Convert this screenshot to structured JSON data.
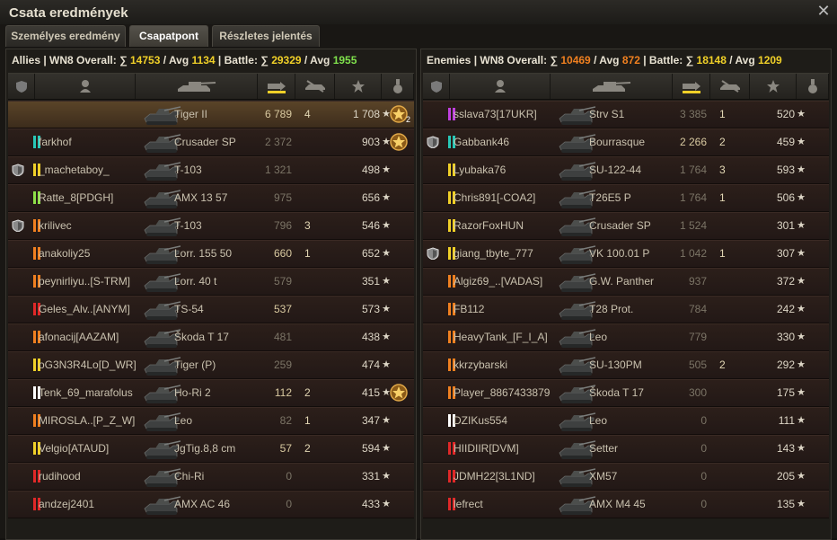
{
  "window": {
    "title": "Csata eredmények"
  },
  "tabs": [
    {
      "label": "Személyes eredmény",
      "active": false
    },
    {
      "label": "Csapatpont",
      "active": true
    },
    {
      "label": "Részletes jelentés",
      "active": false
    }
  ],
  "allies": {
    "label": "Allies",
    "wn8": "WN8 Overall:",
    "sigma1": "∑",
    "overall_sum": "14753",
    "sep1": "/ Avg",
    "overall_avg": "1134",
    "battle": "| Battle:",
    "sigma2": "∑",
    "battle_sum": "29329",
    "sep2": "/ Avg",
    "battle_avg": "1955",
    "rows": [
      {
        "player": "",
        "bar": "",
        "shield": false,
        "me": true,
        "vehicle": "Tiger II",
        "damage": "6 789",
        "kills": "4",
        "xp": "1 708",
        "medal": true,
        "medal_count": "2",
        "dim": false
      },
      {
        "player": "farkhof",
        "bar": "#28c8b8",
        "shield": false,
        "vehicle": "Crusader SP",
        "damage": "2 372",
        "kills": "",
        "xp": "903",
        "medal": true,
        "medal_count": "",
        "dim": true
      },
      {
        "player": "_machetaboy_",
        "bar": "#f0d028",
        "shield": true,
        "vehicle": "T-103",
        "damage": "1 321",
        "kills": "",
        "xp": "498",
        "medal": false,
        "dim": true
      },
      {
        "player": "Ratte_8[PDGH]",
        "bar": "#8ee048",
        "shield": false,
        "vehicle": "AMX 13 57",
        "damage": "975",
        "kills": "",
        "xp": "656",
        "medal": false,
        "dim": true
      },
      {
        "player": "krilivec",
        "bar": "#f08020",
        "shield": true,
        "vehicle": "T-103",
        "damage": "796",
        "kills": "3",
        "xp": "546",
        "medal": false,
        "dim": true
      },
      {
        "player": "anakoliy25",
        "bar": "#f08020",
        "shield": false,
        "vehicle": "Lorr. 155 50",
        "damage": "660",
        "kills": "1",
        "xp": "652",
        "medal": false,
        "dim": false
      },
      {
        "player": "peynirliyu..[S-TRM]",
        "bar": "#f08020",
        "shield": false,
        "vehicle": "Lorr. 40 t",
        "damage": "579",
        "kills": "",
        "xp": "351",
        "medal": false,
        "dim": true
      },
      {
        "player": "Geles_Alv..[ANYM]",
        "bar": "#e02828",
        "shield": false,
        "vehicle": "TS-54",
        "damage": "537",
        "kills": "",
        "xp": "573",
        "medal": false,
        "dim": false
      },
      {
        "player": "afonacij[AAZAM]",
        "bar": "#f08020",
        "shield": false,
        "vehicle": "Škoda T 17",
        "damage": "481",
        "kills": "",
        "xp": "438",
        "medal": false,
        "dim": true
      },
      {
        "player": "oG3N3R4Lo[D_WR]",
        "bar": "#f0d028",
        "shield": false,
        "vehicle": "Tiger (P)",
        "damage": "259",
        "kills": "",
        "xp": "474",
        "medal": false,
        "dim": true
      },
      {
        "player": "Tenk_69_marafolus",
        "bar": "#ffffff",
        "shield": false,
        "vehicle": "Ho-Ri 2",
        "damage": "112",
        "kills": "2",
        "xp": "415",
        "medal": true,
        "medal_count": "",
        "dim": false
      },
      {
        "player": "MIROSLA..[P_Z_W]",
        "bar": "#f08020",
        "shield": false,
        "vehicle": "Leo",
        "damage": "82",
        "kills": "1",
        "xp": "347",
        "medal": false,
        "dim": true
      },
      {
        "player": "Velgio[ATAUD]",
        "bar": "#f0d028",
        "shield": false,
        "vehicle": "JgTig.8,8 cm",
        "damage": "57",
        "kills": "2",
        "xp": "594",
        "medal": false,
        "dim": false
      },
      {
        "player": "rudihood",
        "bar": "#e02828",
        "shield": false,
        "vehicle": "Chi-Ri",
        "damage": "0",
        "kills": "",
        "xp": "331",
        "medal": false,
        "dim": true
      },
      {
        "player": "andzej2401",
        "bar": "#e02828",
        "shield": false,
        "vehicle": "AMX AC 46",
        "damage": "0",
        "kills": "",
        "xp": "433",
        "medal": false,
        "dim": true
      }
    ]
  },
  "enemies": {
    "label": "Enemies",
    "wn8": "WN8 Overall:",
    "sigma1": "∑",
    "overall_sum": "10469",
    "sep1": "/ Avg",
    "overall_avg": "872",
    "battle": "| Battle:",
    "sigma2": "∑",
    "battle_sum": "18148",
    "sep2": "/ Avg",
    "battle_avg": "1209",
    "rows": [
      {
        "player": "sslava73[17UKR]",
        "bar": "#c040e0",
        "shield": false,
        "vehicle": "Strv S1",
        "damage": "3 385",
        "kills": "1",
        "xp": "520",
        "dim": true
      },
      {
        "player": "Gabbank46",
        "bar": "#28c8b8",
        "shield": true,
        "vehicle": "Bourrasque",
        "damage": "2 266",
        "kills": "2",
        "xp": "459",
        "dim": false
      },
      {
        "player": "Lyubaka76",
        "bar": "#f0d028",
        "shield": false,
        "vehicle": "SU-122-44",
        "damage": "1 764",
        "kills": "3",
        "xp": "593",
        "dim": true
      },
      {
        "player": "Chris891[-COA2]",
        "bar": "#f0d028",
        "shield": false,
        "vehicle": "T26E5 P",
        "damage": "1 764",
        "kills": "1",
        "xp": "506",
        "dim": true
      },
      {
        "player": "RazorFoxHUN",
        "bar": "#f0d028",
        "shield": false,
        "vehicle": "Crusader SP",
        "damage": "1 524",
        "kills": "",
        "xp": "301",
        "dim": true
      },
      {
        "player": "giang_tbyte_777",
        "bar": "#f0d028",
        "shield": true,
        "vehicle": "VK 100.01 P",
        "damage": "1 042",
        "kills": "1",
        "xp": "307",
        "dim": true
      },
      {
        "player": "Algiz69_..[VADAS]",
        "bar": "#f08020",
        "shield": false,
        "vehicle": "G.W. Panther",
        "damage": "937",
        "kills": "",
        "xp": "372",
        "dim": true
      },
      {
        "player": "FB112",
        "bar": "#f08020",
        "shield": false,
        "vehicle": "T28 Prot.",
        "damage": "784",
        "kills": "",
        "xp": "242",
        "dim": true
      },
      {
        "player": "HeavyTank_[F_I_A]",
        "bar": "#f08020",
        "shield": false,
        "vehicle": "Leo",
        "damage": "779",
        "kills": "",
        "xp": "330",
        "dim": true
      },
      {
        "player": "kkrzybarski",
        "bar": "#f08020",
        "shield": false,
        "vehicle": "SU-130PM",
        "damage": "505",
        "kills": "2",
        "xp": "292",
        "dim": true
      },
      {
        "player": "Player_8867433879",
        "bar": "#f08020",
        "shield": false,
        "vehicle": "Škoda T 17",
        "damage": "300",
        "kills": "",
        "xp": "175",
        "dim": true
      },
      {
        "player": "DZIKus554",
        "bar": "#ffffff",
        "shield": false,
        "vehicle": "Leo",
        "damage": "0",
        "kills": "",
        "xp": "111",
        "dim": true
      },
      {
        "player": "HIIDIIR[DVM]",
        "bar": "#e02828",
        "shield": false,
        "vehicle": "Setter",
        "damage": "0",
        "kills": "",
        "xp": "143",
        "dim": true
      },
      {
        "player": "JDMH22[3L1ND]",
        "bar": "#e02828",
        "shield": false,
        "vehicle": "XM57",
        "damage": "0",
        "kills": "",
        "xp": "205",
        "dim": true
      },
      {
        "player": "lefrect",
        "bar": "#e02828",
        "shield": false,
        "vehicle": "AMX M4 45",
        "damage": "0",
        "kills": "",
        "xp": "135",
        "dim": true
      }
    ]
  },
  "icons": {
    "star": "★",
    "close": "✕"
  }
}
